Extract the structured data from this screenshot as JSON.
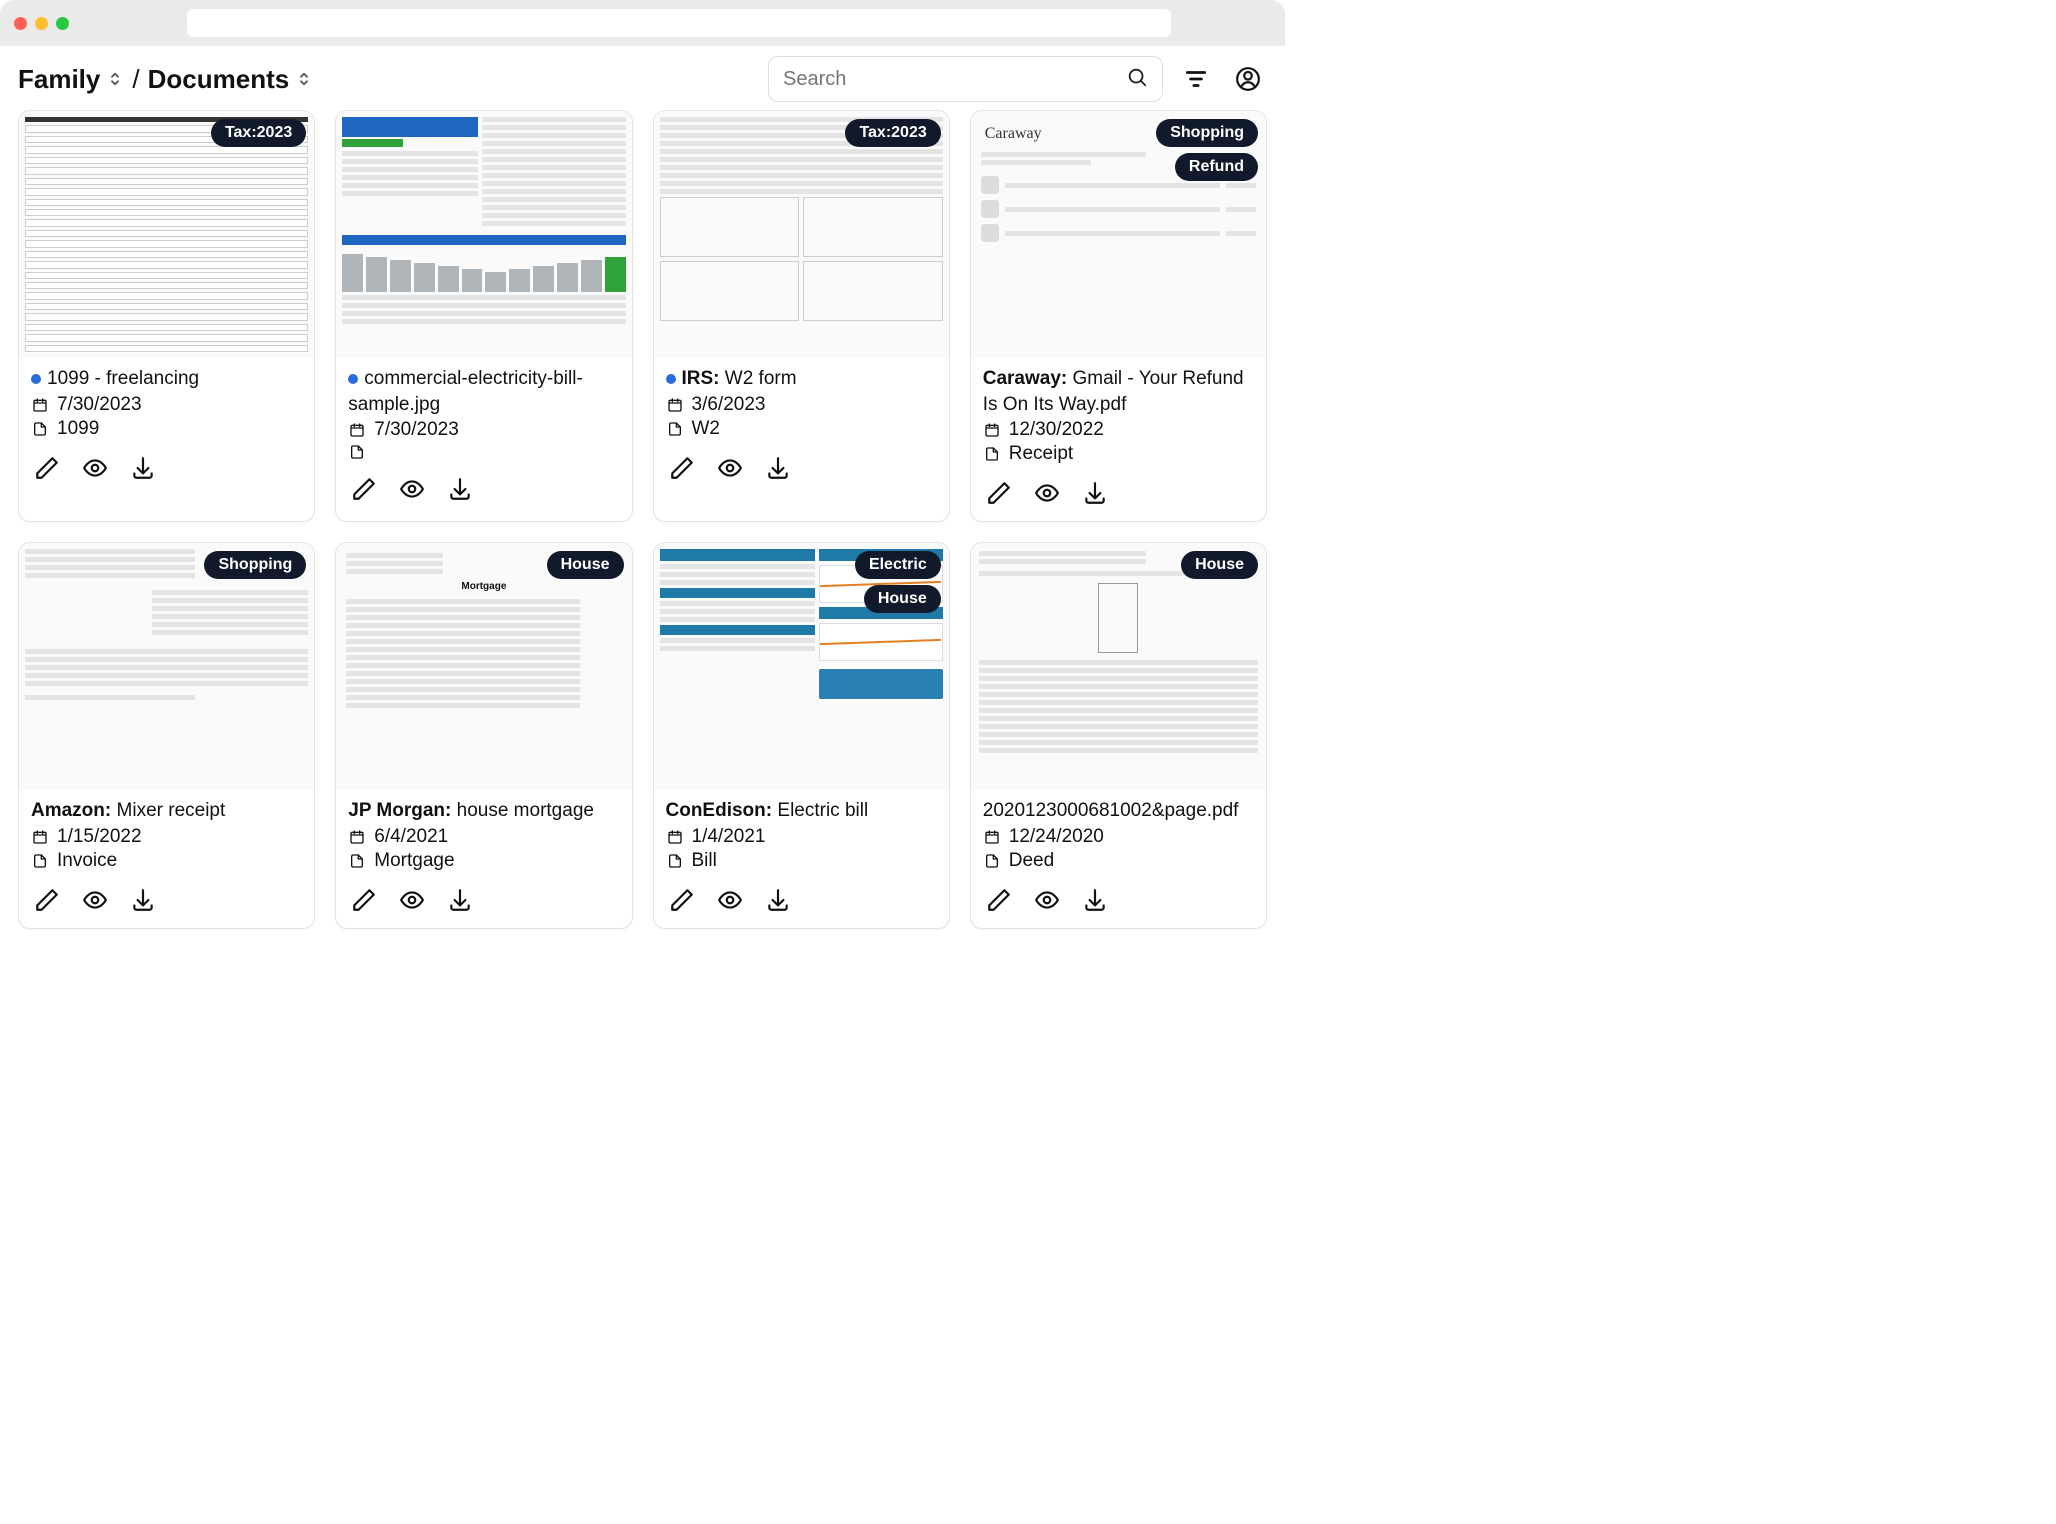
{
  "breadcrumb": {
    "workspace": "Family",
    "section": "Documents"
  },
  "search": {
    "placeholder": "Search"
  },
  "cards": [
    {
      "tags": [
        "Tax:2023"
      ],
      "has_dot": true,
      "bold_prefix": "",
      "title": "1099 - freelancing",
      "date": "7/30/2023",
      "doctype": "1099",
      "thumb_style": "form"
    },
    {
      "tags": [],
      "has_dot": true,
      "bold_prefix": "",
      "title": "commercial-electricity-bill-sample.jpg",
      "date": "7/30/2023",
      "doctype": "",
      "thumb_style": "utility"
    },
    {
      "tags": [
        "Tax:2023"
      ],
      "has_dot": true,
      "bold_prefix": "IRS:",
      "title": "W2 form",
      "date": "3/6/2023",
      "doctype": "W2",
      "thumb_style": "w2"
    },
    {
      "tags": [
        "Shopping",
        "Refund"
      ],
      "has_dot": false,
      "bold_prefix": "Caraway:",
      "title": "Gmail - Your Refund Is On Its Way.pdf",
      "date": "12/30/2022",
      "doctype": "Receipt",
      "thumb_style": "email"
    },
    {
      "tags": [
        "Shopping"
      ],
      "has_dot": false,
      "bold_prefix": "Amazon:",
      "title": "Mixer receipt",
      "date": "1/15/2022",
      "doctype": "Invoice",
      "thumb_style": "invoice"
    },
    {
      "tags": [
        "House"
      ],
      "has_dot": false,
      "bold_prefix": "JP Morgan:",
      "title": "house mortgage",
      "date": "6/4/2021",
      "doctype": "Mortgage",
      "thumb_style": "mortgage"
    },
    {
      "tags": [
        "Electric",
        "House"
      ],
      "has_dot": false,
      "bold_prefix": "ConEdison:",
      "title": "Electric bill",
      "date": "1/4/2021",
      "doctype": "Bill",
      "thumb_style": "coned"
    },
    {
      "tags": [
        "House"
      ],
      "has_dot": false,
      "bold_prefix": "",
      "title": "2020123000681002&page.pdf",
      "date": "12/24/2020",
      "doctype": "Deed",
      "thumb_style": "deed"
    }
  ]
}
